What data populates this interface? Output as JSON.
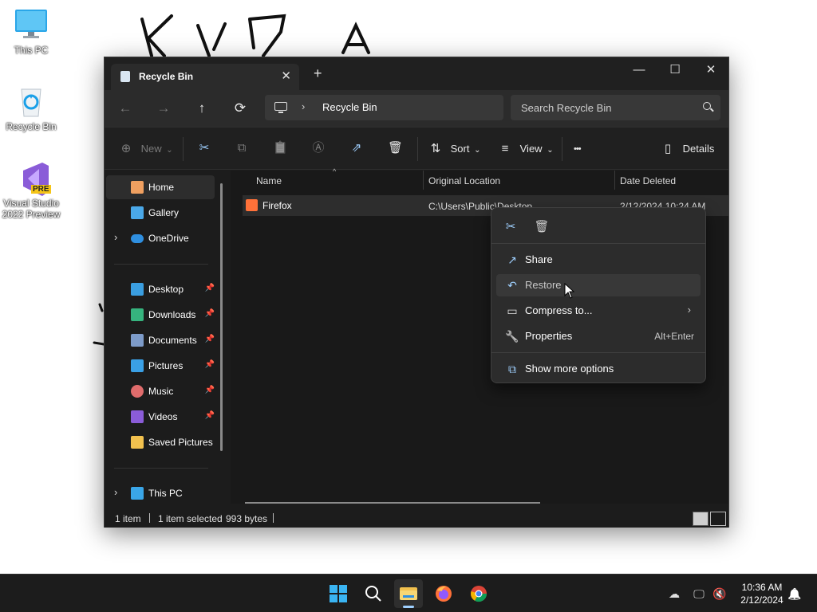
{
  "desktop": {
    "icons": [
      {
        "label": "This PC"
      },
      {
        "label": "Recycle Bin"
      },
      {
        "label": "Visual Studio 2022 Preview",
        "badge": "PRE"
      }
    ]
  },
  "window": {
    "tab_title": "Recycle Bin",
    "tab_close": "✕",
    "new_tab": "+",
    "controls": {
      "minimize": "—",
      "maximize": "☐",
      "close": "✕"
    }
  },
  "address": {
    "back": "←",
    "forward": "→",
    "up": "↑",
    "refresh": "⟳",
    "separator": "›",
    "crumb": "Recycle Bin",
    "search_placeholder": "Search Recycle Bin"
  },
  "toolbar": {
    "new_label": "New",
    "sort_label": "Sort",
    "view_label": "View",
    "more_label": "•••",
    "details_label": "Details",
    "new_icon": "⊕",
    "cut_icon": "✂",
    "copy_icon": "⧉",
    "paste_icon": "📋",
    "rename_icon": "Ⓐ",
    "share_icon": "⇗",
    "delete_icon": "🗑",
    "sort_icon": "⇅",
    "view_icon": "≡",
    "details_icon": "▯",
    "dropdown_caret": "⌄"
  },
  "nav": {
    "items": [
      {
        "label": "Home",
        "icon": "home-icon"
      },
      {
        "label": "Gallery",
        "icon": "gallery-icon"
      },
      {
        "label": "OneDrive",
        "icon": "cloud-icon"
      },
      {
        "label": "Desktop",
        "icon": "desktop-folder-icon",
        "pinned": true
      },
      {
        "label": "Downloads",
        "icon": "download-icon",
        "pinned": true
      },
      {
        "label": "Documents",
        "icon": "document-icon",
        "pinned": true
      },
      {
        "label": "Pictures",
        "icon": "pictures-icon",
        "pinned": true
      },
      {
        "label": "Music",
        "icon": "music-icon",
        "pinned": true
      },
      {
        "label": "Videos",
        "icon": "video-icon",
        "pinned": true
      },
      {
        "label": "Saved Pictures",
        "icon": "folder-icon"
      },
      {
        "label": "This PC",
        "icon": "pc-icon"
      }
    ],
    "expander": "›",
    "pin": "📌"
  },
  "filelist": {
    "columns": [
      "Name",
      "Original Location",
      "Date Deleted"
    ],
    "sort_caret": "^",
    "rows": [
      {
        "name": "Firefox",
        "location": "C:\\Users\\Public\\Desktop",
        "date": "2/12/2024 10:24 AM"
      }
    ]
  },
  "status": {
    "count": "1 item",
    "selected": "1 item selected",
    "size": "993 bytes"
  },
  "context_menu": {
    "quick": {
      "cut": "✂",
      "delete": "🗑"
    },
    "items": [
      {
        "label": "Share",
        "icon": "↗",
        "accel": ""
      },
      {
        "label": "Restore",
        "icon": "↶",
        "accel": ""
      },
      {
        "label": "Compress to...",
        "icon": "▭",
        "arrow": "›"
      },
      {
        "label": "Properties",
        "icon": "🔧",
        "accel": "Alt+Enter"
      },
      {
        "label": "Show more options",
        "icon": "⧉"
      }
    ]
  },
  "taskbar": {
    "clock_time": "10:36 AM",
    "clock_date": "2/12/2024",
    "search_icon": "⚲",
    "bell_icon": "🔔"
  }
}
